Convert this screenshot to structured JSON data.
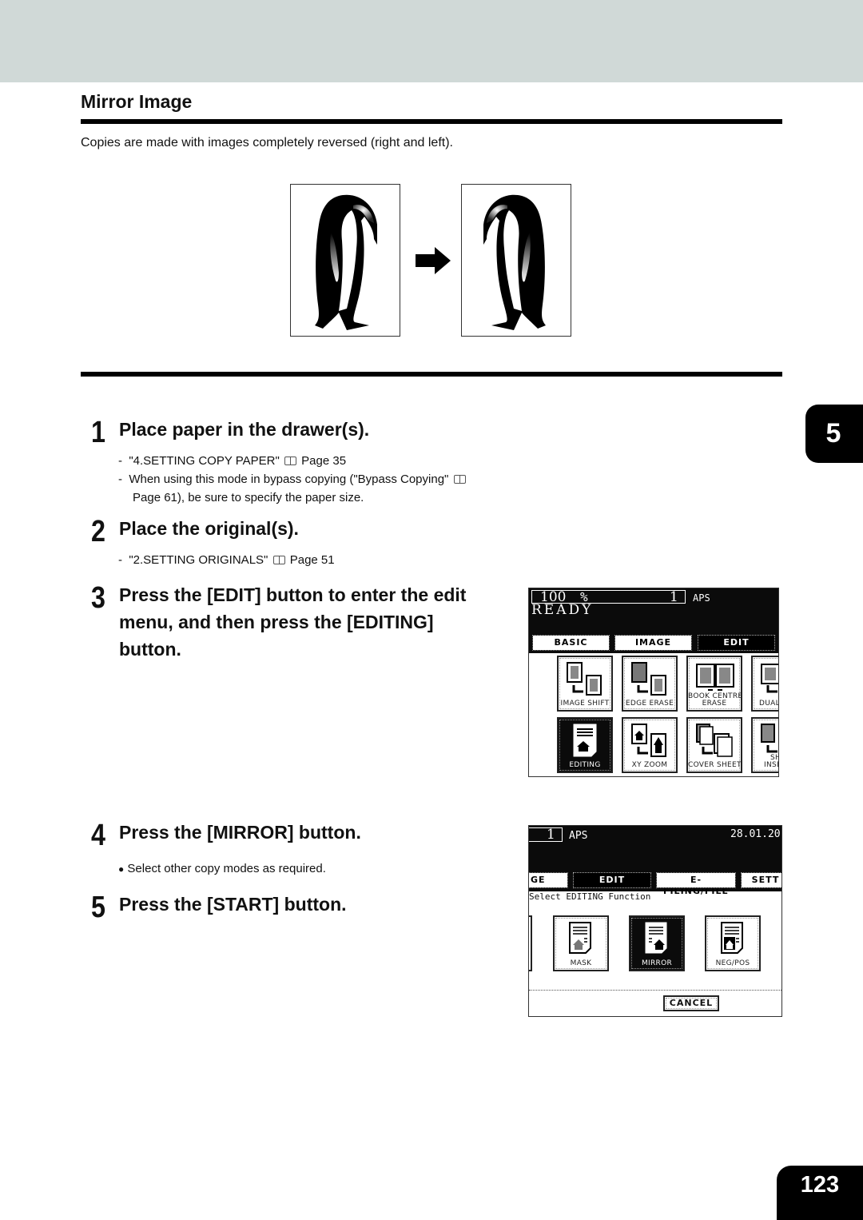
{
  "header": {
    "band_color": "#d0d9d7"
  },
  "section": {
    "title": "Mirror Image",
    "intro": "Copies are made with images completely reversed (right and left)."
  },
  "figure": {
    "original_icon": "penguin-original",
    "arrow_icon": "right-arrow",
    "mirrored_icon": "penguin-mirrored"
  },
  "steps": [
    {
      "number": "1",
      "title": "Place paper in the drawer(s).",
      "notes": [
        {
          "bullet": "-",
          "text": "\"4.SETTING COPY PAPER\"",
          "ref": "Page 35"
        },
        {
          "bullet": "-",
          "text": "When using this mode in bypass copying (\"Bypass Copying\"",
          "ref": "",
          "cont": "Page 61), be sure to specify the paper size."
        }
      ]
    },
    {
      "number": "2",
      "title": "Place the original(s).",
      "notes": [
        {
          "bullet": "-",
          "text": "\"2.SETTING ORIGINALS\"",
          "ref": "Page 51"
        }
      ]
    },
    {
      "number": "3",
      "title_lines": [
        "Press the [EDIT] button to enter the edit",
        "menu, and then press the [EDITING]",
        "button."
      ]
    },
    {
      "number": "4",
      "title": "Press the [MIRROR] button.",
      "notes": [
        {
          "bullet": "●",
          "text": "Select other copy modes as required."
        }
      ]
    },
    {
      "number": "5",
      "title": "Press the [START] button."
    }
  ],
  "screen1": {
    "zoom": "100",
    "percent": "%",
    "copies": "1",
    "paper": "APS",
    "status": "READY",
    "tabs": [
      "BASIC",
      "IMAGE",
      "EDIT"
    ],
    "active_tab": "EDIT",
    "buttons": [
      {
        "label": "IMAGE SHIFT",
        "icon": "image-shift-icon"
      },
      {
        "label": "EDGE ERASE",
        "icon": "edge-erase-icon"
      },
      {
        "label": "BOOK CENTRE",
        "label2": "ERASE",
        "icon": "book-centre-erase-icon"
      },
      {
        "label": "DUAL",
        "icon": "dual-page-icon"
      },
      {
        "label": "EDITING",
        "icon": "editing-icon",
        "selected": true
      },
      {
        "label": "XY ZOOM",
        "icon": "xy-zoom-icon"
      },
      {
        "label": "COVER SHEET",
        "icon": "cover-sheet-icon"
      },
      {
        "label": "SH",
        "label2": "INSE",
        "icon": "sheet-insertion-icon"
      }
    ]
  },
  "screen2": {
    "copies": "1",
    "paper": "APS",
    "date": "28.01.20",
    "tabs": [
      "GE",
      "EDIT",
      "E-FILING/FILE",
      "SETT"
    ],
    "active_tab": "EDIT",
    "prompt": "Select EDITING Function",
    "buttons": [
      {
        "label": "MASK",
        "icon": "mask-icon"
      },
      {
        "label": "MIRROR",
        "icon": "mirror-icon",
        "selected": true
      },
      {
        "label": "NEG/POS",
        "icon": "neg-pos-icon"
      }
    ],
    "cancel": "CANCEL"
  },
  "chapter_tab": "5",
  "page_number": "123"
}
